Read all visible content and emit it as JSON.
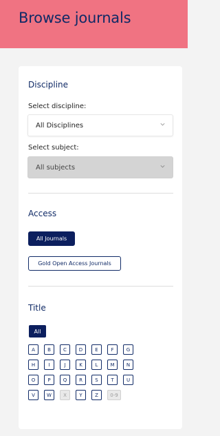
{
  "header": {
    "title": "Browse journals"
  },
  "discipline": {
    "heading": "Discipline",
    "select_discipline_label": "Select discipline:",
    "select_discipline_value": "All Disciplines",
    "select_subject_label": "Select subject:",
    "select_subject_value": "All subjects"
  },
  "access": {
    "heading": "Access",
    "options": [
      "All Journals",
      "Gold Open Access Journals"
    ]
  },
  "title_filter": {
    "heading": "Title",
    "all_label": "All",
    "letters": [
      "A",
      "B",
      "C",
      "D",
      "E",
      "F",
      "G",
      "H",
      "I",
      "J",
      "K",
      "L",
      "M",
      "N",
      "O",
      "P",
      "Q",
      "R",
      "S",
      "T",
      "U",
      "V",
      "W",
      "X",
      "Y",
      "Z",
      "0-9"
    ],
    "disabled": [
      "X",
      "0-9"
    ]
  },
  "colors": {
    "header_bg": "#f07382",
    "navy": "#102a66",
    "active_pill": "#0c1f5e"
  }
}
